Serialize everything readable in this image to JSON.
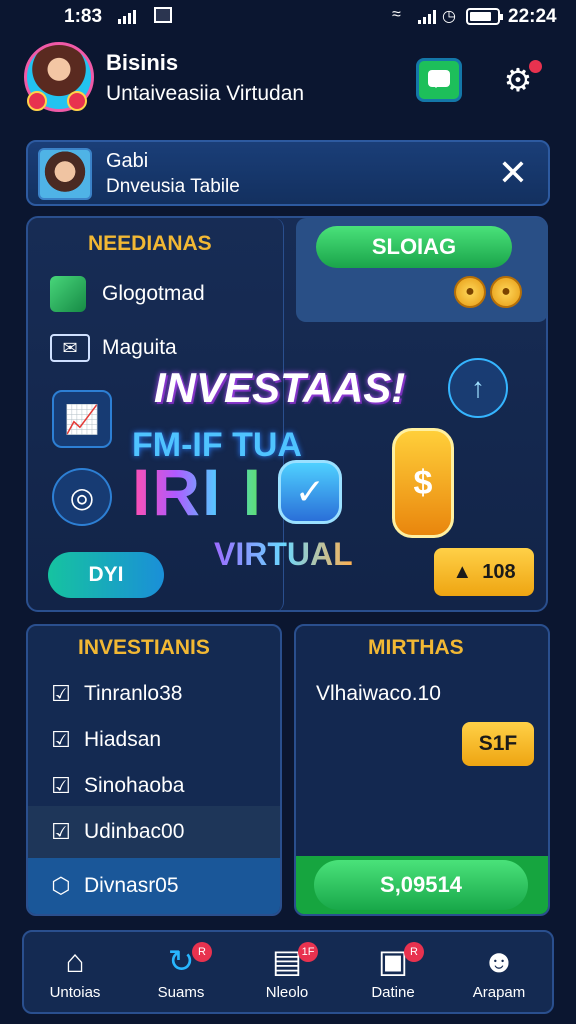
{
  "status_bar": {
    "time": "1:83",
    "clock": "22:24",
    "icons": [
      "signal-icon",
      "notification-icon",
      "wifi-icon",
      "cell-signal-icon",
      "alarm-icon",
      "battery-icon"
    ]
  },
  "header": {
    "title": "Bisinis",
    "subtitle": "Untaiveasiia Virtudan",
    "icons": [
      "message-icon",
      "gear-icon"
    ]
  },
  "notification": {
    "name": "Gabi",
    "text": "Dnveusia Tabile"
  },
  "menu": {
    "title": "NEEDIANAS",
    "items": [
      {
        "label": "Glogotmad",
        "icon": "cube-icon"
      },
      {
        "label": "Maguita",
        "icon": "mail-icon"
      }
    ],
    "side_icons": [
      "growth-chart-icon",
      "target-icon"
    ]
  },
  "promo": {
    "button_label": "SLOIAG",
    "coins": [
      "coin-icon",
      "coin-icon"
    ]
  },
  "hero": {
    "line1": "INVESTAAS!",
    "line2": "FM-IF TUA",
    "line3": "IRI  I",
    "line4": "VIRTUAL",
    "pill_label": "DYI",
    "badge_value": "108",
    "icons": [
      "trend-circle-icon",
      "upload-arrow-icon",
      "check-shield-icon",
      "dollar-coin-icon",
      "bell-icon"
    ]
  },
  "investments": {
    "title": "INVESTIANIS",
    "items": [
      {
        "label": "Tinranlo38"
      },
      {
        "label": "Hiadsan"
      },
      {
        "label": "Sinohaoba"
      },
      {
        "label": "Udinbac00"
      },
      {
        "label": "Divnasr05"
      }
    ]
  },
  "earnings": {
    "title": "MIRTHAS",
    "value_text": "Vlhaiwaco.10",
    "badge": "S1F",
    "button_label": "S,09514"
  },
  "bottom_nav": {
    "items": [
      {
        "label": "Untoias",
        "icon": "home-icon",
        "badge": ""
      },
      {
        "label": "Suams",
        "icon": "search-refresh-icon",
        "badge": "R"
      },
      {
        "label": "Nleolo",
        "icon": "document-icon",
        "badge": "1F"
      },
      {
        "label": "Datine",
        "icon": "camera-icon",
        "badge": "R"
      },
      {
        "label": "Arapam",
        "icon": "profile-icon",
        "badge": ""
      }
    ]
  }
}
